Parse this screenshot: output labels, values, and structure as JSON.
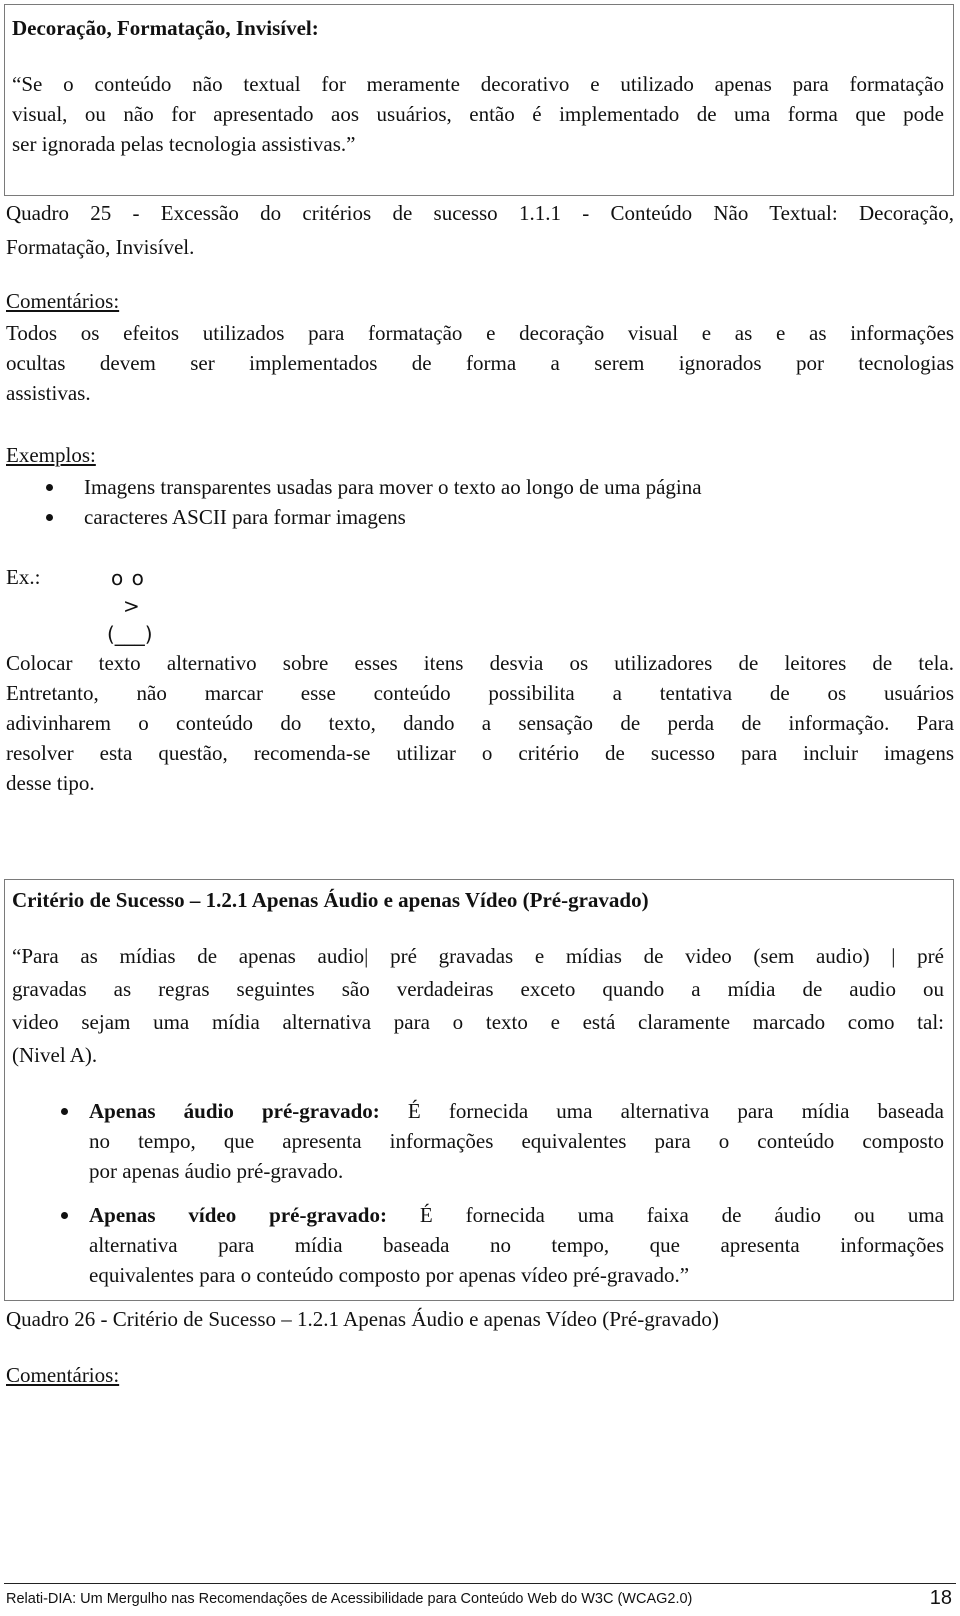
{
  "box1": {
    "title": "Decoração, Formatação, Invisível:",
    "quote_lines": [
      "“Se o conteúdo não textual for meramente decorativo e utilizado apenas para formatação",
      "visual, ou não for apresentado aos usuários, então é implementado de uma forma que pode",
      "ser ignorada pelas tecnologia assistivas.”"
    ]
  },
  "caption1": {
    "lines": [
      "Quadro 25 -  Excessão do critérios de sucesso 1.1.1 - Conteúdo Não Textual: Decoração,",
      "Formatação, Invisível."
    ]
  },
  "comments1": {
    "heading": "Comentários:",
    "lines": [
      "Todos os efeitos utilizados para formatação e decoração visual e as e as informações",
      "ocultas devem ser implementados de forma a serem ignorados por tecnologias",
      "assistivas."
    ]
  },
  "examples": {
    "heading": "Exemplos:",
    "items": [
      "Imagens transparentes usadas para mover o texto ao longo de uma página",
      "caracteres ASCII para formar imagens"
    ]
  },
  "ascii_example": {
    "label": "Ex.:",
    "lines": [
      "o o",
      ">",
      "(___)"
    ]
  },
  "paragraph1": {
    "lines": [
      "Colocar texto alternativo sobre esses itens desvia os utilizadores de leitores de tela.",
      "Entretanto, não marcar esse conteúdo possibilita a tentativa de os usuários",
      "adivinharem o conteúdo do texto, dando a sensação de perda de informação. Para",
      "resolver esta questão, recomenda-se utilizar o critério de sucesso para incluir imagens",
      "desse tipo."
    ]
  },
  "box2": {
    "title": "Critério de Sucesso – 1.2.1 Apenas Áudio e apenas Vídeo (Pré-gravado)",
    "quote_lines": [
      "“Para as mídias de apenas audio| pré gravadas e mídias de video (sem audio) | pré",
      "gravadas as regras seguintes são verdadeiras exceto quando a mídia de audio ou",
      "video sejam uma mídia alternativa para o texto e está claramente marcado como tal:",
      "(Nivel A)."
    ],
    "bullets": [
      {
        "term": "Apenas áudio pré-gravado:",
        "lines": [
          " É fornecida uma alternativa para mídia baseada",
          "no tempo, que apresenta informações equivalentes para o conteúdo composto",
          "por apenas áudio pré-gravado."
        ]
      },
      {
        "term": "Apenas vídeo pré-gravado:",
        "lines": [
          " É fornecida uma faixa de áudio ou uma",
          "alternativa para mídia baseada no tempo, que apresenta informações",
          "equivalentes para o conteúdo composto por apenas vídeo pré-gravado.”"
        ]
      }
    ]
  },
  "caption2": {
    "text": "Quadro 26 - Critério de Sucesso – 1.2.1 Apenas Áudio e apenas Vídeo (Pré-gravado)"
  },
  "comments2": {
    "heading": "Comentários:"
  },
  "footer": {
    "text": "Relati-DIA: Um Mergulho nas Recomendações de Acessibilidade para Conteúdo Web do W3C (WCAG2.0)",
    "page_number": "18"
  }
}
